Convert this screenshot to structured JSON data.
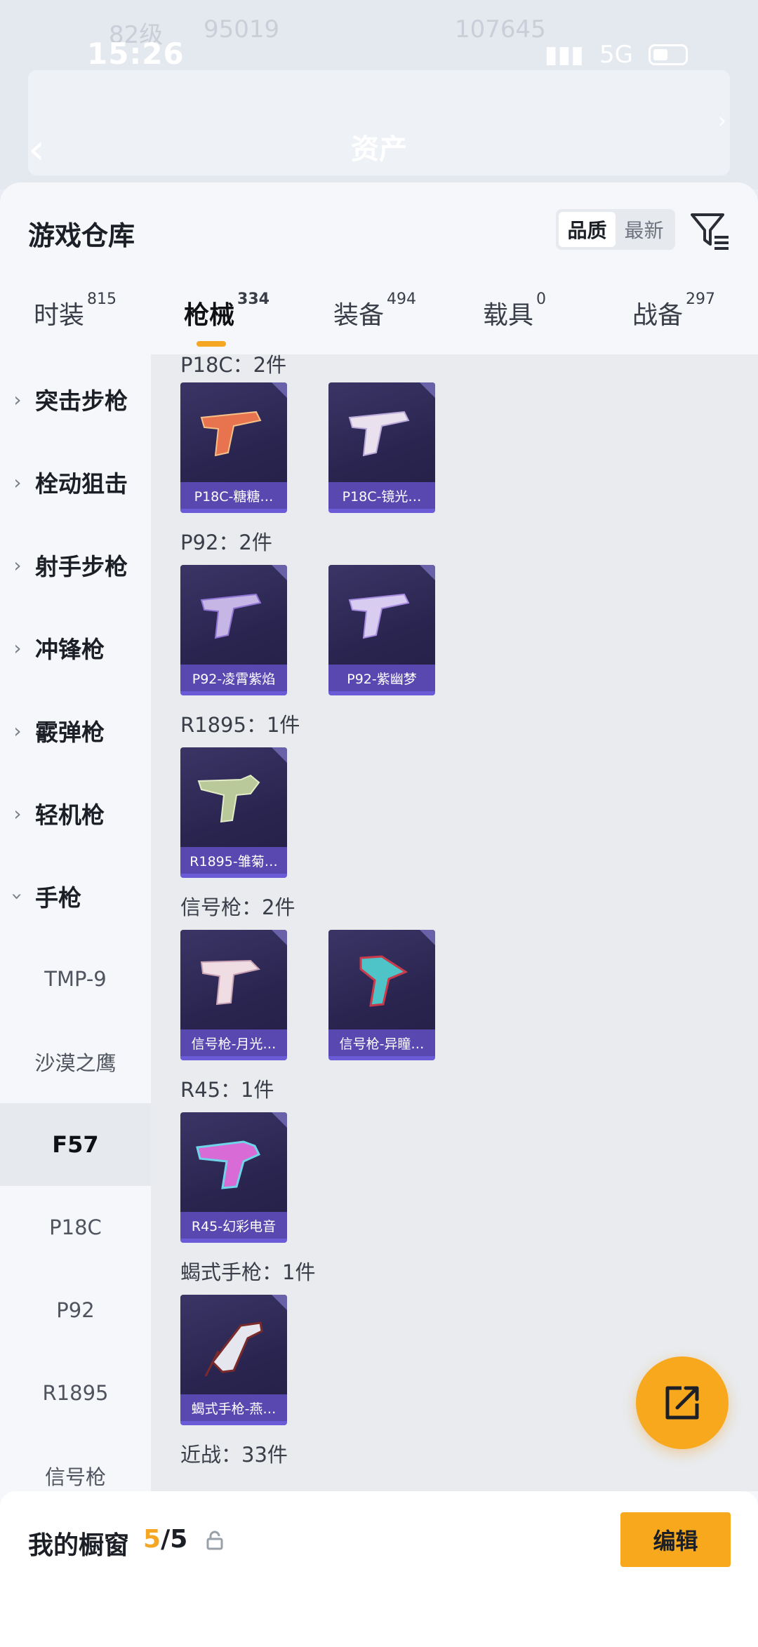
{
  "status_bar": {
    "time": "15:26",
    "network": "5G"
  },
  "background_header": {
    "ghost_level": "82级",
    "ghost_coins": "95019",
    "ghost_power": "107645",
    "title": "资产"
  },
  "sheet": {
    "title": "游戏仓库",
    "sort": {
      "options": [
        "品质",
        "最新"
      ],
      "active": "品质"
    }
  },
  "tabs": [
    {
      "label": "时装",
      "count": "815"
    },
    {
      "label": "枪械",
      "count": "334"
    },
    {
      "label": "装备",
      "count": "494"
    },
    {
      "label": "载具",
      "count": "0"
    },
    {
      "label": "战备",
      "count": "297"
    }
  ],
  "sidebar": {
    "categories": [
      "突击步枪",
      "栓动狙击",
      "射手步枪",
      "冲锋枪",
      "霰弹枪",
      "轻机枪",
      "手枪"
    ],
    "subitems": [
      "TMP-9",
      "沙漠之鹰",
      "F57",
      "P18C",
      "P92",
      "R1895",
      "信号枪"
    ],
    "active_sub": "F57"
  },
  "content": {
    "groups": [
      {
        "title": "P18C：2件",
        "items": [
          "P18C-糖糖…",
          "P18C-镜光…"
        ]
      },
      {
        "title": "P92：2件",
        "items": [
          "P92-凌霄紫焰",
          "P92-紫幽梦"
        ]
      },
      {
        "title": "R1895：1件",
        "items": [
          "R1895-雏菊…"
        ]
      },
      {
        "title": "信号枪：2件",
        "items": [
          "信号枪-月光…",
          "信号枪-异瞳…"
        ]
      },
      {
        "title": "R45：1件",
        "items": [
          "R45-幻彩电音"
        ]
      },
      {
        "title": "蝎式手枪：1件",
        "items": [
          "蝎式手枪-燕…"
        ]
      },
      {
        "title": "近战：33件",
        "items": []
      }
    ]
  },
  "showcase": {
    "label": "我的橱窗",
    "current": "5",
    "total": "/5",
    "edit_label": "编辑"
  },
  "colors": {
    "accent": "#f5a623",
    "card_bg": "#2a2550",
    "card_label": "#5848b0"
  }
}
